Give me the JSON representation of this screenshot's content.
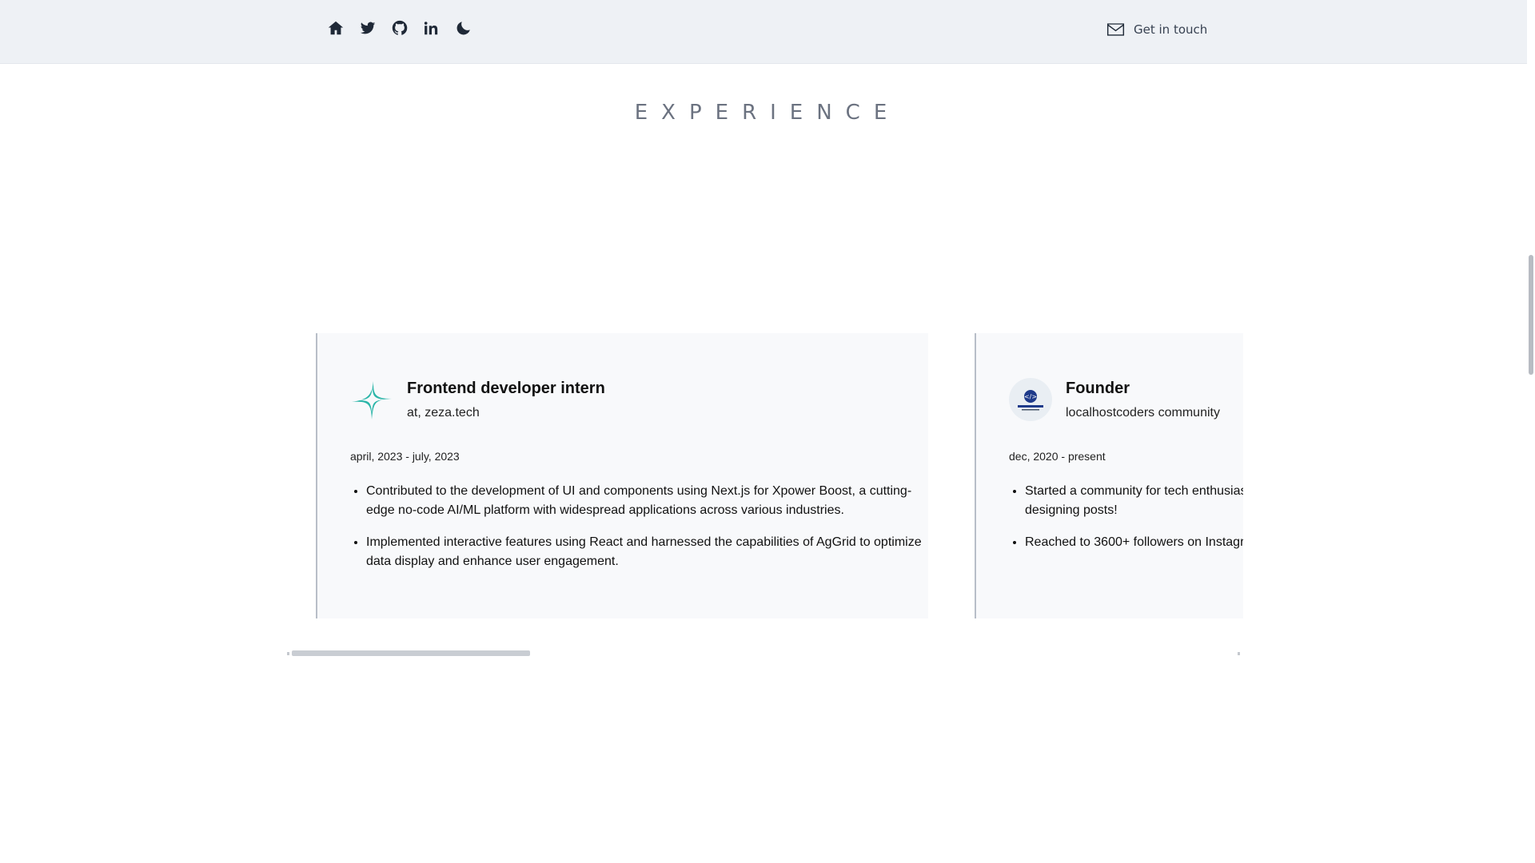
{
  "nav": {
    "icons": [
      "home-icon",
      "twitter-icon",
      "github-icon",
      "linkedin-icon",
      "moon-icon"
    ],
    "contact_label": "Get in touch"
  },
  "section": {
    "title": "EXPERIENCE"
  },
  "experience": [
    {
      "role": "Frontend developer intern",
      "company": "at, zeza.tech",
      "dates": "april, 2023 - july, 2023",
      "bullets": [
        "Contributed to the development of UI and components using Next.js for Xpower Boost, a cutting-edge no-code AI/ML platform with widespread applications across various industries.",
        "Implemented interactive features using React and harnessed the capabilities of AgGrid to optimize data display and enhance user engagement."
      ]
    },
    {
      "role": "Founder",
      "company": "localhostcoders community",
      "dates": "dec, 2020 - present",
      "bullets": [
        "Started a community for tech enthusias",
        "designing posts!",
        "Reached to 3600+ followers on Instagr"
      ]
    }
  ],
  "carousel_scroll": {
    "position_fraction": 0.0
  },
  "colors": {
    "topbar": "#eef1f5",
    "card": "#f8f9fb",
    "accent_logo": "#2bb5a8"
  }
}
